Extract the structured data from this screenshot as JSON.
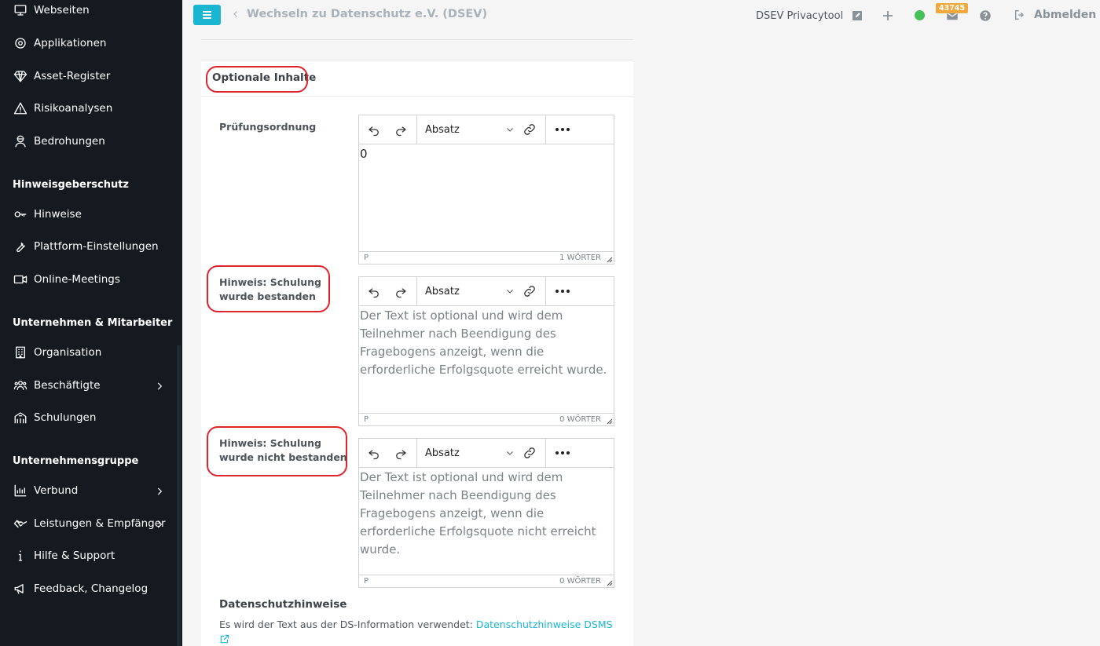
{
  "sidebar": {
    "items": [
      {
        "label": "Webseiten",
        "icon": "monitor-icon"
      },
      {
        "label": "Applikationen",
        "icon": "target-icon"
      },
      {
        "label": "Asset-Register",
        "icon": "diamond-icon"
      },
      {
        "label": "Risikoanalysen",
        "icon": "warning-icon"
      },
      {
        "label": "Bedrohungen",
        "icon": "bandit-icon"
      },
      {
        "label": "Hinweise",
        "icon": "key-icon"
      },
      {
        "label": "Plattform-Einstellungen",
        "icon": "wrench-icon"
      },
      {
        "label": "Online-Meetings",
        "icon": "video-icon"
      },
      {
        "label": "Organisation",
        "icon": "building-icon"
      },
      {
        "label": "Beschäftigte",
        "icon": "users-icon"
      },
      {
        "label": "Schulungen",
        "icon": "school-icon"
      },
      {
        "label": "Verbund",
        "icon": "chart-icon"
      },
      {
        "label": "Leistungen & Empfänger",
        "icon": "handshake-icon"
      },
      {
        "label": "Hilfe & Support",
        "icon": "info-icon"
      },
      {
        "label": "Feedback, Changelog",
        "icon": "megaphone-icon"
      }
    ],
    "headers": {
      "hinweisgeberschutz": "Hinweisgeberschutz",
      "unternehmen": "Unternehmen & Mitarbeiter",
      "gruppe": "Unternehmensgruppe"
    }
  },
  "topbar": {
    "back_label": "Wechseln zu Datenschutz e.V. (DSEV)",
    "app_name": "DSEV Privacytool",
    "mail_count": "43745",
    "logout_label": "Abmelden",
    "status_color": "#48c05a",
    "accent_color": "#1ab5d1"
  },
  "card": {
    "title": "Optionale Inhalte",
    "fields": [
      {
        "label_line1": "Prüfungsordnung",
        "label_line2": "",
        "format": "Absatz",
        "content": "0",
        "is_placeholder": false,
        "status_path": "P",
        "word_count": "1 WÖRTER"
      },
      {
        "label_line1": "Hinweis: Schulung",
        "label_line2": "wurde bestanden",
        "format": "Absatz",
        "content": "Der Text ist optional und wird dem Teilnehmer nach Beendigung des Fragebogens anzeigt, wenn die erforderliche Erfolgsquote erreicht wurde.",
        "is_placeholder": true,
        "status_path": "P",
        "word_count": "0 WÖRTER"
      },
      {
        "label_line1": "Hinweis: Schulung",
        "label_line2": "wurde nicht bestanden",
        "format": "Absatz",
        "content": "Der Text ist optional und wird dem Teilnehmer nach Beendigung des Fragebogens anzeigt, wenn die erforderliche Erfolgsquote nicht erreicht wurde.",
        "is_placeholder": true,
        "status_path": "P",
        "word_count": "0 WÖRTER"
      }
    ],
    "privacy": {
      "title": "Datenschutzhinweise",
      "text": "Es wird der Text aus der DS-Information verwendet: ",
      "link": "Datenschutzhinweise DSMS"
    }
  }
}
